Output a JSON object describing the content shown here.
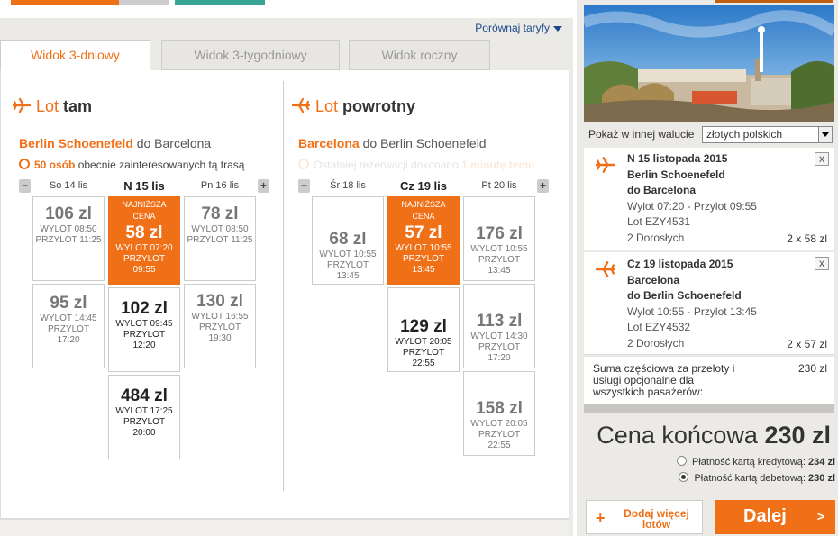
{
  "compare_label": "Porównaj taryfy",
  "tabs": [
    {
      "label": "Widok 3-dniowy"
    },
    {
      "label": "Widok 3-tygodniowy"
    },
    {
      "label": "Widok roczny"
    }
  ],
  "outbound": {
    "title_part1": "Lot",
    "title_part2": "tam",
    "origin": "Berlin Schoenefeld",
    "connector": "do",
    "destination": "Barcelona",
    "interest_count": "50 osób",
    "interest_text": "obecnie zainteresowanych tą trasą",
    "days": [
      {
        "label": "So 14 lis"
      },
      {
        "label": "N 15 lis"
      },
      {
        "label": "Pn 16 lis"
      }
    ],
    "fares": [
      {
        "price": "106 zl",
        "line1": "WYLOT 08:50",
        "line2": "PRZYLOT 11:25"
      },
      {
        "price": "95 zl",
        "line1": "WYLOT 14:45",
        "line2": "PRZYLOT",
        "line3": "17:20"
      },
      {
        "badge1": "NAJNIŻSZA",
        "badge2": "CENA",
        "price": "58 zl",
        "line1": "WYLOT 07:20",
        "line2": "PRZYLOT",
        "line3": "09:55"
      },
      {
        "price": "102 zl",
        "line1": "WYLOT 09:45",
        "line2": "PRZYLOT",
        "line3": "12:20"
      },
      {
        "price": "484 zl",
        "line1": "WYLOT 17:25",
        "line2": "PRZYLOT",
        "line3": "20:00"
      },
      {
        "price": "78 zl",
        "line1": "WYLOT 08:50",
        "line2": "PRZYLOT 11:25"
      },
      {
        "price": "130 zl",
        "line1": "WYLOT 16:55",
        "line2": "PRZYLOT",
        "line3": "19:30"
      }
    ]
  },
  "inbound": {
    "title_part1": "Lot",
    "title_part2": "powrotny",
    "origin": "Barcelona",
    "connector": "do",
    "destination": "Berlin Schoenefeld",
    "last_res_text": "Ostatniej rezerwacji dokonano",
    "last_res_time": "1 minutę temu",
    "days": [
      {
        "label": "Śr 18 lis"
      },
      {
        "label": "Cz 19 lis"
      },
      {
        "label": "Pt 20 lis"
      }
    ],
    "fares": [
      {
        "price": "68 zl",
        "line1": "WYLOT 10:55",
        "line2": "PRZYLOT",
        "line3": "13:45"
      },
      {
        "badge1": "NAJNIŻSZA",
        "badge2": "CENA",
        "price": "57 zl",
        "line1": "WYLOT 10:55",
        "line2": "PRZYLOT",
        "line3": "13:45"
      },
      {
        "price": "129 zl",
        "line1": "WYLOT 20:05",
        "line2": "PRZYLOT",
        "line3": "22:55"
      },
      {
        "price": "176 zl",
        "line1": "WYLOT 10:55",
        "line2": "PRZYLOT",
        "line3": "13:45"
      },
      {
        "price": "113 zl",
        "line1": "WYLOT 14:30",
        "line2": "PRZYLOT",
        "line3": "17:20"
      },
      {
        "price": "158 zl",
        "line1": "WYLOT 20:05",
        "line2": "PRZYLOT",
        "line3": "22:55"
      }
    ]
  },
  "sidebar": {
    "currency_label": "Pokaż w innej walucie",
    "currency_value": "złotych polskich",
    "flight1": {
      "date": "N 15 listopada 2015",
      "from": "Berlin Schoenefeld",
      "to": "do Barcelona",
      "times": "Wylot 07:20 - Przylot 09:55",
      "flight_no": "Lot EZY4531",
      "pax": "2 Dorosłych",
      "price": "2 x 58 zl"
    },
    "flight2": {
      "date": "Cz 19 listopada 2015",
      "from": "Barcelona",
      "to": "do Berlin Schoenefeld",
      "times": "Wylot 10:55 - Przylot 13:45",
      "flight_no": "Lot EZY4532",
      "pax": "2 Dorosłych",
      "price": "2 x 57 zl"
    },
    "close_glyph": "x",
    "subtotal_l1": "Suma częściowa za przeloty i",
    "subtotal_l2": "usługi opcjonalne dla",
    "subtotal_l3": "wszystkich pasażerów:",
    "subtotal_value": "230 zl",
    "final_label": "Cena końcowa",
    "final_value": "230 zl",
    "pay_credit_label": "Płatność kartą kredytową:",
    "pay_credit_value": "234 zl",
    "pay_debit_label": "Płatność kartą debetową:",
    "pay_debit_value": "230 zl",
    "add_label_l1": "Dodaj więcej",
    "add_label_l2": "lotów",
    "next_label": "Dalej"
  },
  "colors": {
    "accent": "#f07018",
    "link": "#1a4a8a"
  }
}
